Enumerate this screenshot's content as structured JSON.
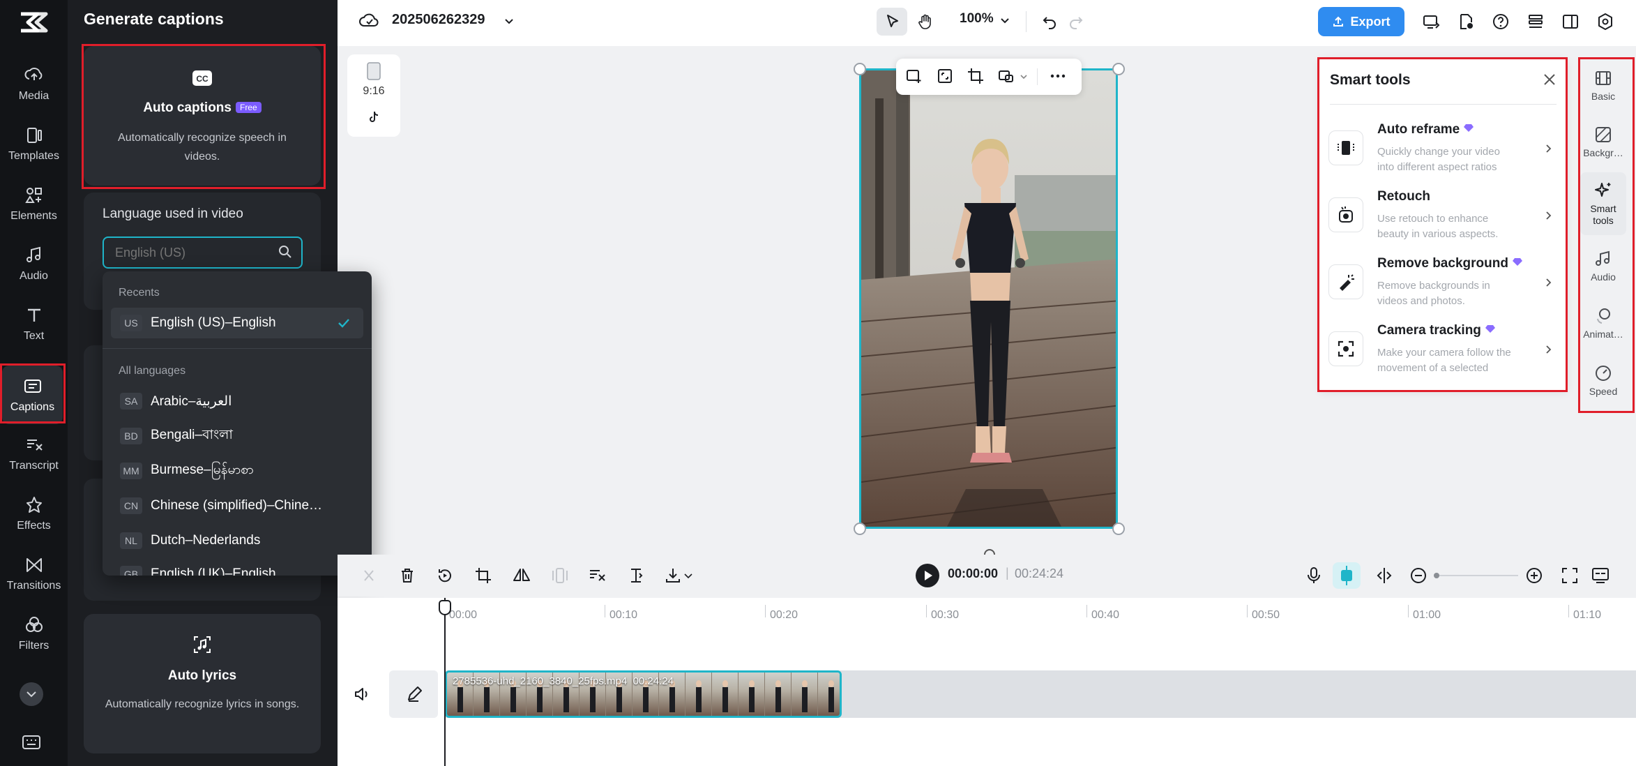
{
  "rail": {
    "items": [
      {
        "label": "Media",
        "icon": "media-icon"
      },
      {
        "label": "Templates",
        "icon": "templates-icon"
      },
      {
        "label": "Elements",
        "icon": "elements-icon"
      },
      {
        "label": "Audio",
        "icon": "audio-icon"
      },
      {
        "label": "Text",
        "icon": "text-icon"
      },
      {
        "label": "Captions",
        "icon": "captions-icon",
        "active": true
      },
      {
        "label": "Transcript",
        "icon": "transcript-icon"
      },
      {
        "label": "Effects",
        "icon": "effects-icon"
      },
      {
        "label": "Transitions",
        "icon": "transitions-icon"
      },
      {
        "label": "Filters",
        "icon": "filters-icon"
      }
    ]
  },
  "panel": {
    "title": "Generate captions",
    "auto_captions": {
      "title": "Auto captions",
      "badge": "Free",
      "desc": "Automatically recognize speech in videos."
    },
    "language_label": "Language used in video",
    "language_placeholder": "English (US)",
    "auto_lyrics": {
      "title": "Auto lyrics",
      "desc": "Automatically recognize lyrics in songs."
    }
  },
  "dropdown": {
    "recents_label": "Recents",
    "recents": [
      {
        "code": "US",
        "name": "English (US)–English",
        "selected": true
      }
    ],
    "all_label": "All languages",
    "languages": [
      {
        "code": "SA",
        "name": "Arabic–العربية"
      },
      {
        "code": "BD",
        "name": "Bengali–বাংলা"
      },
      {
        "code": "MM",
        "name": "Burmese–မြန်မာစာ"
      },
      {
        "code": "CN",
        "name": "Chinese (simplified)–Chine…"
      },
      {
        "code": "NL",
        "name": "Dutch–Nederlands"
      },
      {
        "code": "GB",
        "name": "English (UK)–English"
      }
    ]
  },
  "topbar": {
    "project_name": "202506262329",
    "zoom": "100%",
    "export_label": "Export"
  },
  "ratio": {
    "label": "9:16"
  },
  "smart_tools": {
    "title": "Smart tools",
    "tools": [
      {
        "name": "Auto reframe",
        "premium": true,
        "desc": "Quickly change your video into different aspect ratios and kee…",
        "icon": "auto-reframe-icon"
      },
      {
        "name": "Retouch",
        "premium": false,
        "desc": "Use retouch to enhance beauty in various aspects.",
        "icon": "retouch-icon"
      },
      {
        "name": "Remove background",
        "premium": true,
        "desc": "Remove backgrounds in videos and photos.",
        "icon": "remove-background-icon"
      },
      {
        "name": "Camera tracking",
        "premium": true,
        "desc": "Make your camera follow the movement of a selected target.",
        "icon": "camera-tracking-icon"
      }
    ]
  },
  "right_rail": {
    "items": [
      {
        "label": "Basic"
      },
      {
        "label": "Backgr…"
      },
      {
        "label": "Smart tools",
        "active": true
      },
      {
        "label": "Audio"
      },
      {
        "label": "Animat…"
      },
      {
        "label": "Speed"
      }
    ]
  },
  "player": {
    "current_time": "00:00:00",
    "separator": "|",
    "duration": "00:24:24"
  },
  "timeline": {
    "ticks": [
      "00:00",
      "00:10",
      "00:20",
      "00:30",
      "00:40",
      "00:50",
      "01:00",
      "01:10"
    ],
    "clip": {
      "filename": "2785536-uhd_2160_3840_25fps.mp4",
      "duration": "00:24:24"
    }
  },
  "colors": {
    "accent": "#1fb5c9",
    "export": "#2f8cf0",
    "highlight": "#e01e2a",
    "premium": "#8a6cff"
  }
}
